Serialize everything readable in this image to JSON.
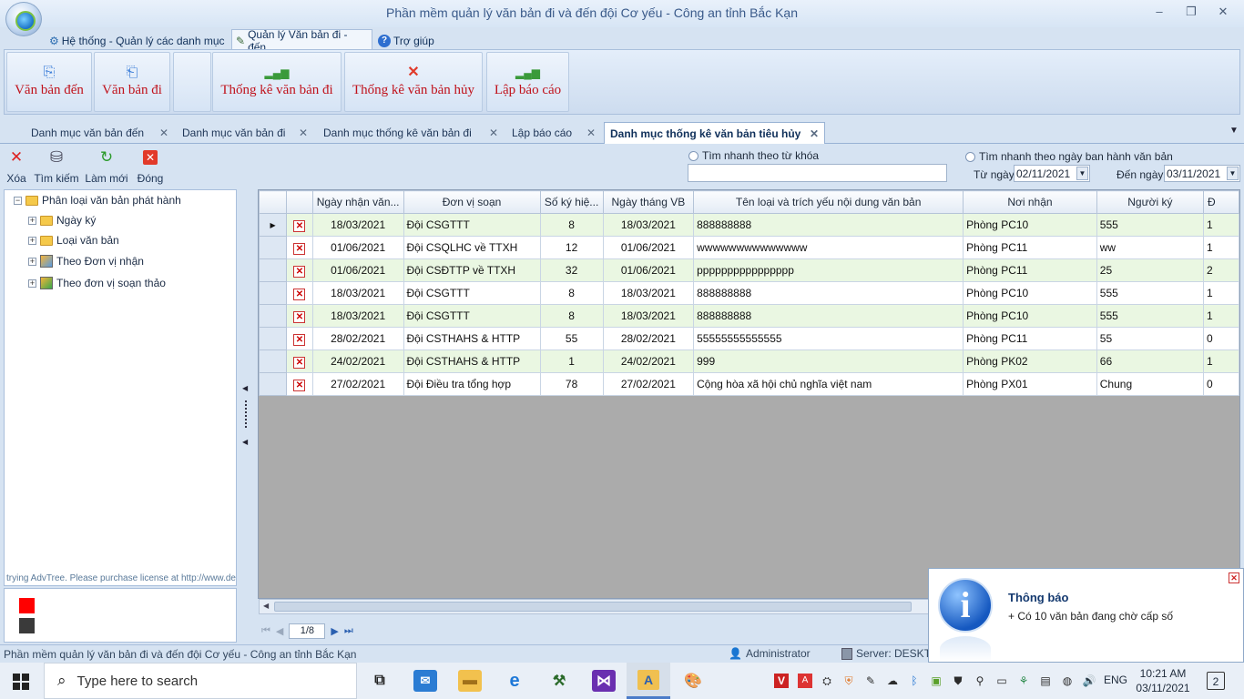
{
  "window": {
    "title": "Phần mềm quản lý văn bản đi và đến đội Cơ yếu - Công an tỉnh Bắc Kạn",
    "controls": {
      "minimize": "–",
      "maximize": "❐",
      "close": "✕"
    }
  },
  "menu": {
    "items": [
      {
        "label": "Hệ thống - Quản lý các danh mục",
        "icon": "gear-icon"
      },
      {
        "label": "Quản lý Văn bản đi - đến",
        "icon": "pen-icon",
        "active": true
      },
      {
        "label": "Trợ giúp",
        "icon": "help-icon"
      }
    ]
  },
  "ribbon": {
    "buttons": [
      {
        "label": "Văn bản đến",
        "icon": "incoming-doc-icon"
      },
      {
        "label": "Văn bản đi",
        "icon": "outgoing-doc-icon"
      },
      {
        "label": "",
        "icon": ""
      },
      {
        "label": "Thống kê văn bản đi",
        "icon": "bar-chart-icon"
      },
      {
        "label": "Thống kê văn bản hủy",
        "icon": "cancel-x-icon"
      },
      {
        "label": "Lập báo cáo",
        "icon": "bar-chart-icon"
      }
    ]
  },
  "doctabs": [
    {
      "label": "Danh mục văn bản đến",
      "close": "✕"
    },
    {
      "label": "Danh mục văn bản đi",
      "close": "✕"
    },
    {
      "label": "Danh mục thống kê văn bản đi",
      "close": "✕"
    },
    {
      "label": "Lập báo cáo",
      "close": "✕"
    },
    {
      "label": "Danh mục thống kê văn bản tiêu hủy",
      "close": "✕",
      "active": true
    }
  ],
  "toolbar": {
    "delete": "Xóa",
    "search": "Tìm kiếm",
    "refresh": "Làm mới",
    "close": "Đóng",
    "quick_keyword_label": "Tìm nhanh theo từ khóa",
    "quick_keyword_value": "",
    "quick_date_label": "Tìm nhanh theo ngày ban hành văn bản",
    "from_label": "Từ ngày",
    "from_value": "02/11/2021",
    "to_label": "Đến ngày",
    "to_value": "03/11/2021"
  },
  "tree": {
    "root": "Phân loại văn bản phát hành",
    "children": [
      "Ngày ký",
      "Loại văn bản",
      "Theo Đơn vị nhận",
      "Theo đơn vị soạn thảo"
    ],
    "trial_text": "trying AdvTree. Please purchase license at http://www.devco"
  },
  "legend": {
    "colors": [
      "#ff0000",
      "#3a3a3a"
    ]
  },
  "grid": {
    "columns": [
      "Ngày nhận văn...",
      "Đơn vị soạn",
      "Số ký hiệ...",
      "Ngày tháng VB",
      "Tên loại và trích yếu nội dung văn bản",
      "Nơi nhận",
      "Người ký",
      "Đ"
    ],
    "rows": [
      [
        "18/03/2021",
        "Đội CSGTTT",
        "8",
        "18/03/2021",
        "888888888",
        "Phòng PC10",
        "555",
        "1"
      ],
      [
        "01/06/2021",
        "Đội CSQLHC về TTXH",
        "12",
        "01/06/2021",
        "wwwwwwwwwwwwww",
        "Phòng PC11",
        "ww",
        "1"
      ],
      [
        "01/06/2021",
        "Đội CSĐTTP về TTXH",
        "32",
        "01/06/2021",
        "pppppppppppppppp",
        "Phòng PC11",
        "25",
        "2"
      ],
      [
        "18/03/2021",
        "Đội CSGTTT",
        "8",
        "18/03/2021",
        "888888888",
        "Phòng PC10",
        "555",
        "1"
      ],
      [
        "18/03/2021",
        "Đội CSGTTT",
        "8",
        "18/03/2021",
        "888888888",
        "Phòng PC10",
        "555",
        "1"
      ],
      [
        "28/02/2021",
        "Đội CSTHAHS & HTTP",
        "55",
        "28/02/2021",
        "55555555555555",
        "Phòng PC11",
        "55",
        "0"
      ],
      [
        "24/02/2021",
        "Đội CSTHAHS & HTTP",
        "1",
        "24/02/2021",
        "999",
        "Phòng PK02",
        "66",
        "1"
      ],
      [
        "27/02/2021",
        "Đội Điều tra tổng hợp",
        "78",
        "27/02/2021",
        "Cộng hòa xã hội chủ nghĩa việt nam",
        "Phòng PX01",
        "Chung",
        "0"
      ]
    ]
  },
  "pager": {
    "page": "1/8"
  },
  "statusbar": {
    "app": "Phần mềm quản lý văn bản đi và đến đội Cơ yếu - Công an tỉnh Bắc Kạn",
    "user": "Administrator",
    "server": "Server: DESKTO"
  },
  "notification": {
    "title": "Thông báo",
    "message": "+ Có 10 văn bản đang chờ cấp số"
  },
  "taskbar": {
    "search_placeholder": "Type here to search",
    "lang": "ENG",
    "time": "10:21 AM",
    "date": "03/11/2021",
    "notif_count": "2"
  }
}
